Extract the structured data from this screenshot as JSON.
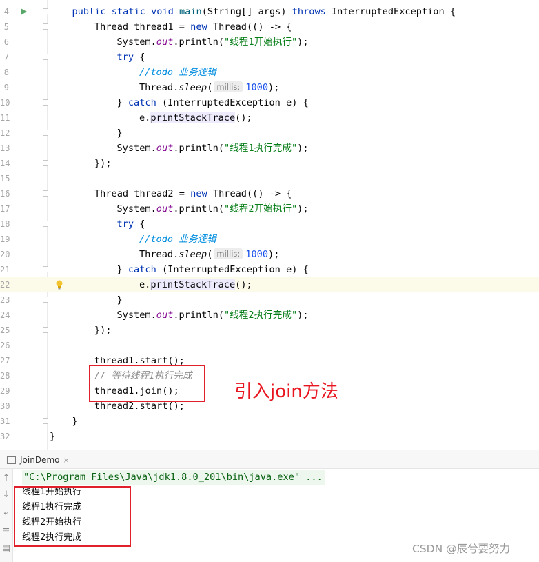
{
  "editor": {
    "lines": [
      {
        "num": "4",
        "indent": 1,
        "tokens": [
          {
            "t": "public static void ",
            "c": "kw"
          },
          {
            "t": "main",
            "c": "fn"
          },
          {
            "t": "(String[] args) "
          },
          {
            "t": "throws",
            "c": "kw"
          },
          {
            "t": " InterruptedException {"
          }
        ]
      },
      {
        "num": "5",
        "indent": 2,
        "tokens": [
          {
            "t": "Thread thread1 = "
          },
          {
            "t": "new",
            "c": "kw"
          },
          {
            "t": " Thread(() -> {"
          }
        ]
      },
      {
        "num": "6",
        "indent": 3,
        "tokens": [
          {
            "t": "System."
          },
          {
            "t": "out",
            "c": "fld"
          },
          {
            "t": ".println("
          },
          {
            "t": "\"线程1开始执行\"",
            "c": "str"
          },
          {
            "t": ");"
          }
        ]
      },
      {
        "num": "7",
        "indent": 3,
        "tokens": [
          {
            "t": "try",
            "c": "kw"
          },
          {
            "t": " {"
          }
        ]
      },
      {
        "num": "8",
        "indent": 4,
        "tokens": [
          {
            "t": "//todo ",
            "c": "todo"
          },
          {
            "t": "业务逻辑",
            "c": "todo"
          }
        ]
      },
      {
        "num": "9",
        "indent": 4,
        "tokens": [
          {
            "t": "Thread."
          },
          {
            "t": "sleep",
            "c": "mth-i"
          },
          {
            "t": "("
          },
          {
            "t": "millis:",
            "c": "hint"
          },
          {
            "t": "1000",
            "c": "num"
          },
          {
            "t": ");"
          }
        ]
      },
      {
        "num": "10",
        "indent": 3,
        "tokens": [
          {
            "t": "} "
          },
          {
            "t": "catch",
            "c": "kw"
          },
          {
            "t": " (InterruptedException e) {"
          }
        ]
      },
      {
        "num": "11",
        "indent": 4,
        "tokens": [
          {
            "t": "e."
          },
          {
            "t": "printStackTrace",
            "c": "hl"
          },
          {
            "t": "();"
          }
        ]
      },
      {
        "num": "12",
        "indent": 3,
        "tokens": [
          {
            "t": "}"
          }
        ]
      },
      {
        "num": "13",
        "indent": 3,
        "tokens": [
          {
            "t": "System."
          },
          {
            "t": "out",
            "c": "fld"
          },
          {
            "t": ".println("
          },
          {
            "t": "\"线程1执行完成\"",
            "c": "str"
          },
          {
            "t": ");"
          }
        ]
      },
      {
        "num": "14",
        "indent": 2,
        "tokens": [
          {
            "t": "});"
          }
        ]
      },
      {
        "num": "15",
        "indent": 0,
        "tokens": []
      },
      {
        "num": "16",
        "indent": 2,
        "tokens": [
          {
            "t": "Thread thread2 = "
          },
          {
            "t": "new",
            "c": "kw"
          },
          {
            "t": " Thread(() -> {"
          }
        ]
      },
      {
        "num": "17",
        "indent": 3,
        "tokens": [
          {
            "t": "System."
          },
          {
            "t": "out",
            "c": "fld"
          },
          {
            "t": ".println("
          },
          {
            "t": "\"线程2开始执行\"",
            "c": "str"
          },
          {
            "t": ");"
          }
        ]
      },
      {
        "num": "18",
        "indent": 3,
        "tokens": [
          {
            "t": "try",
            "c": "kw"
          },
          {
            "t": " {"
          }
        ]
      },
      {
        "num": "19",
        "indent": 4,
        "tokens": [
          {
            "t": "//todo ",
            "c": "todo"
          },
          {
            "t": "业务逻辑",
            "c": "todo"
          }
        ]
      },
      {
        "num": "20",
        "indent": 4,
        "tokens": [
          {
            "t": "Thread."
          },
          {
            "t": "sleep",
            "c": "mth-i"
          },
          {
            "t": "("
          },
          {
            "t": "millis:",
            "c": "hint"
          },
          {
            "t": "1000",
            "c": "num"
          },
          {
            "t": ");"
          }
        ]
      },
      {
        "num": "21",
        "indent": 3,
        "tokens": [
          {
            "t": "} "
          },
          {
            "t": "catch",
            "c": "kw"
          },
          {
            "t": " (InterruptedException e) {"
          }
        ]
      },
      {
        "num": "22",
        "indent": 4,
        "current": true,
        "tokens": [
          {
            "t": "e."
          },
          {
            "t": "printStackTrace",
            "c": "hl"
          },
          {
            "t": "();"
          }
        ]
      },
      {
        "num": "23",
        "indent": 3,
        "tokens": [
          {
            "t": "}"
          }
        ]
      },
      {
        "num": "24",
        "indent": 3,
        "tokens": [
          {
            "t": "System."
          },
          {
            "t": "out",
            "c": "fld"
          },
          {
            "t": ".println("
          },
          {
            "t": "\"线程2执行完成\"",
            "c": "str"
          },
          {
            "t": ");"
          }
        ]
      },
      {
        "num": "25",
        "indent": 2,
        "tokens": [
          {
            "t": "});"
          }
        ]
      },
      {
        "num": "26",
        "indent": 0,
        "tokens": []
      },
      {
        "num": "27",
        "indent": 2,
        "tokens": [
          {
            "t": "thread1.start();"
          }
        ]
      },
      {
        "num": "28",
        "indent": 2,
        "tokens": [
          {
            "t": "// 等待线程1执行完成",
            "c": "cmt"
          }
        ]
      },
      {
        "num": "29",
        "indent": 2,
        "tokens": [
          {
            "t": "thread1.join();"
          }
        ]
      },
      {
        "num": "30",
        "indent": 2,
        "tokens": [
          {
            "t": "thread2.start();"
          }
        ]
      },
      {
        "num": "31",
        "indent": 1,
        "tokens": [
          {
            "t": "}"
          }
        ]
      },
      {
        "num": "32",
        "indent": 0,
        "tokens": [
          {
            "t": "}"
          }
        ]
      }
    ],
    "annotation": "引入join方法"
  },
  "run_panel": {
    "tab_label": "JoinDemo",
    "tab_close": "×",
    "command": "\"C:\\Program Files\\Java\\jdk1.8.0_201\\bin\\java.exe\" ...",
    "output": [
      "线程1开始执行",
      "线程1执行完成",
      "线程2开始执行",
      "线程2执行完成"
    ]
  },
  "watermark": "CSDN @辰兮要努力",
  "icons": {
    "run": "run-gutter-icon",
    "bulb": "intention-bulb-icon",
    "tools": [
      "rerun-up-icon",
      "down-icon",
      "soft-wrap-icon",
      "scroll-to-end-icon",
      "print-icon"
    ]
  },
  "colors": {
    "keyword": "#0033b3",
    "string": "#067d17",
    "field": "#871094",
    "number": "#1750eb",
    "annotation_red": "#e8141e"
  }
}
